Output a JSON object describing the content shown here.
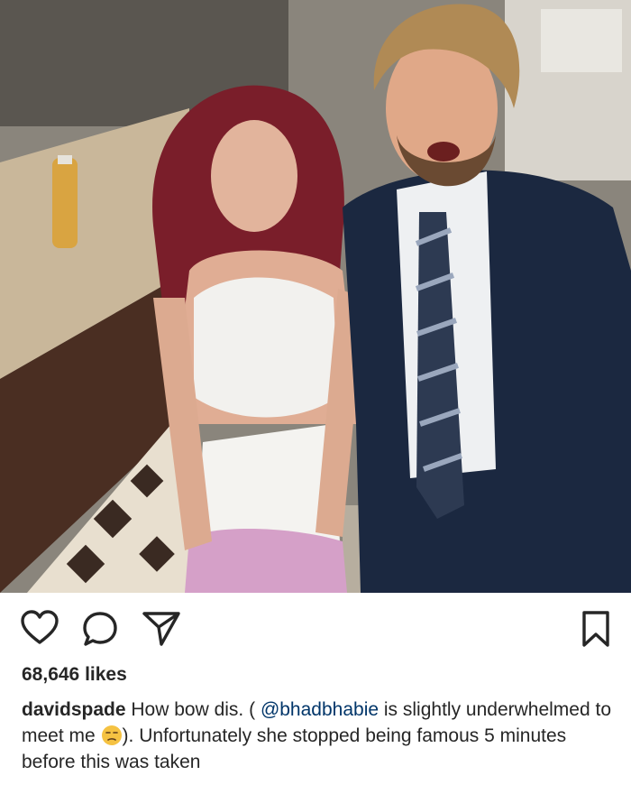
{
  "post": {
    "photo": {
      "description_icon": "photo-of-two-people-icon"
    },
    "actions": {
      "like_icon": "heart-icon",
      "comment_icon": "comment-bubble-icon",
      "share_icon": "paper-plane-icon",
      "save_icon": "bookmark-icon"
    },
    "likes_text": "68,646 likes",
    "caption": {
      "username": "davidspade",
      "text_before_mention": " How bow dis. ( ",
      "mention": "@bhadbhabie",
      "text_after_mention": " is slightly underwhelmed to meet me ",
      "emoji_name": "unamused-face-emoji",
      "text_after_emoji": "). Unfortunately she stopped being famous 5 minutes before this was taken"
    }
  },
  "colors": {
    "text": "#262626",
    "mention": "#003569",
    "emoji": "#f5c242"
  }
}
